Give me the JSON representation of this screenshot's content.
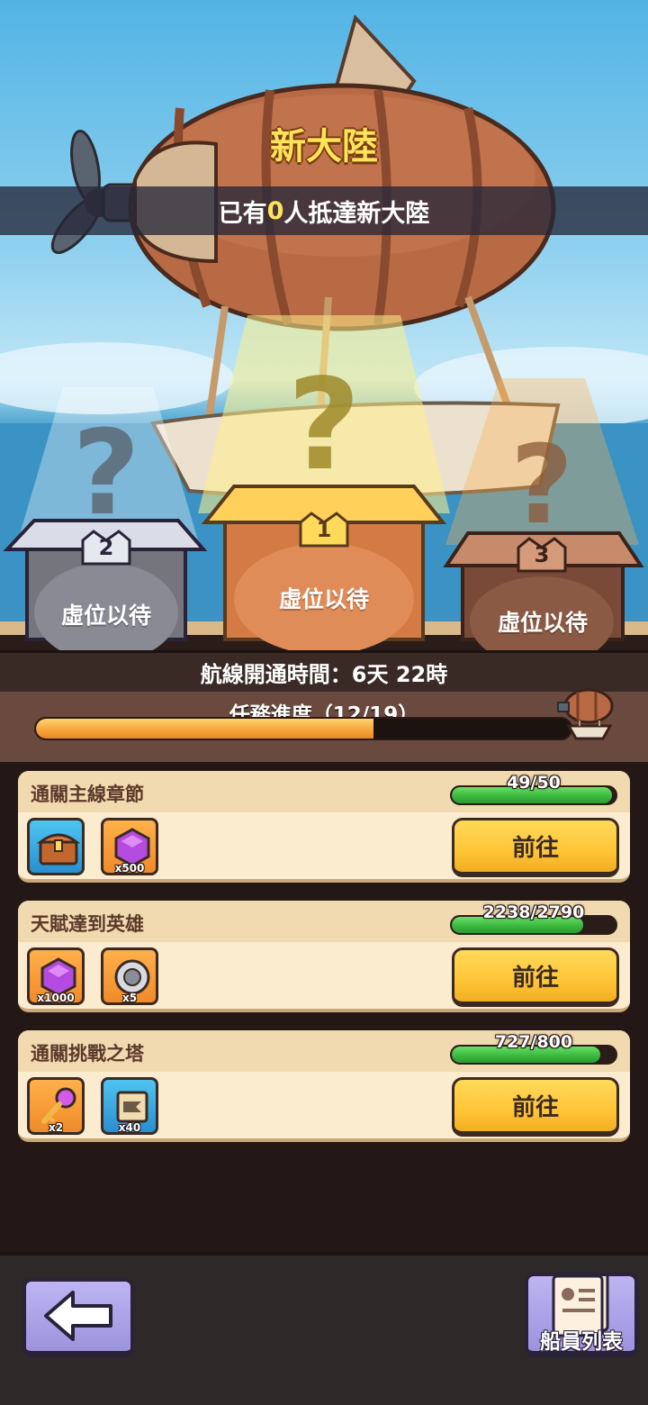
{
  "header": {
    "title": "新大陸",
    "arrival_prefix": "已有",
    "arrival_count": "0",
    "arrival_suffix": "人抵達新大陸"
  },
  "podium": {
    "slots": [
      {
        "rank": "2",
        "label": "虛位以待",
        "color": "silver"
      },
      {
        "rank": "1",
        "label": "虛位以待",
        "color": "gold"
      },
      {
        "rank": "3",
        "label": "虛位以待",
        "color": "bronze"
      }
    ]
  },
  "route": {
    "open_time_label": "航線開通時間：6天 22時",
    "progress_label": "任務進度（12/19）",
    "progress_current": 12,
    "progress_total": 19
  },
  "quests": [
    {
      "name": "通關主線章節",
      "progress_text": "49/50",
      "progress_fraction": 0.98,
      "rewards": [
        {
          "icon": "treasure-chest-icon",
          "qty": "",
          "bg": "blue"
        },
        {
          "icon": "purple-gem-icon",
          "qty": "x500",
          "bg": "orange"
        }
      ],
      "button": "前往"
    },
    {
      "name": "天賦達到英雄",
      "progress_text": "2238/2790",
      "progress_fraction": 0.802,
      "rewards": [
        {
          "icon": "purple-gem-icon",
          "qty": "x1000",
          "bg": "orange"
        },
        {
          "icon": "silver-coin-icon",
          "qty": "x5",
          "bg": "orange"
        }
      ],
      "button": "前往"
    },
    {
      "name": "通關挑戰之塔",
      "progress_text": "727/800",
      "progress_fraction": 0.909,
      "rewards": [
        {
          "icon": "key-icon",
          "qty": "x2",
          "bg": "orange"
        },
        {
          "icon": "scroll-icon",
          "qty": "x40",
          "bg": "blue"
        }
      ],
      "button": "前往"
    }
  ],
  "footer": {
    "back_icon": "back-arrow-icon",
    "crew_list_label": "船員列表",
    "crew_icon": "crew-document-icon"
  },
  "colors": {
    "title_gold": "#ffe45a",
    "progress_orange": "#f5a23a",
    "quest_green": "#3aba3e",
    "button_yellow": "#ffc537",
    "button_purple": "#9c93dd"
  }
}
